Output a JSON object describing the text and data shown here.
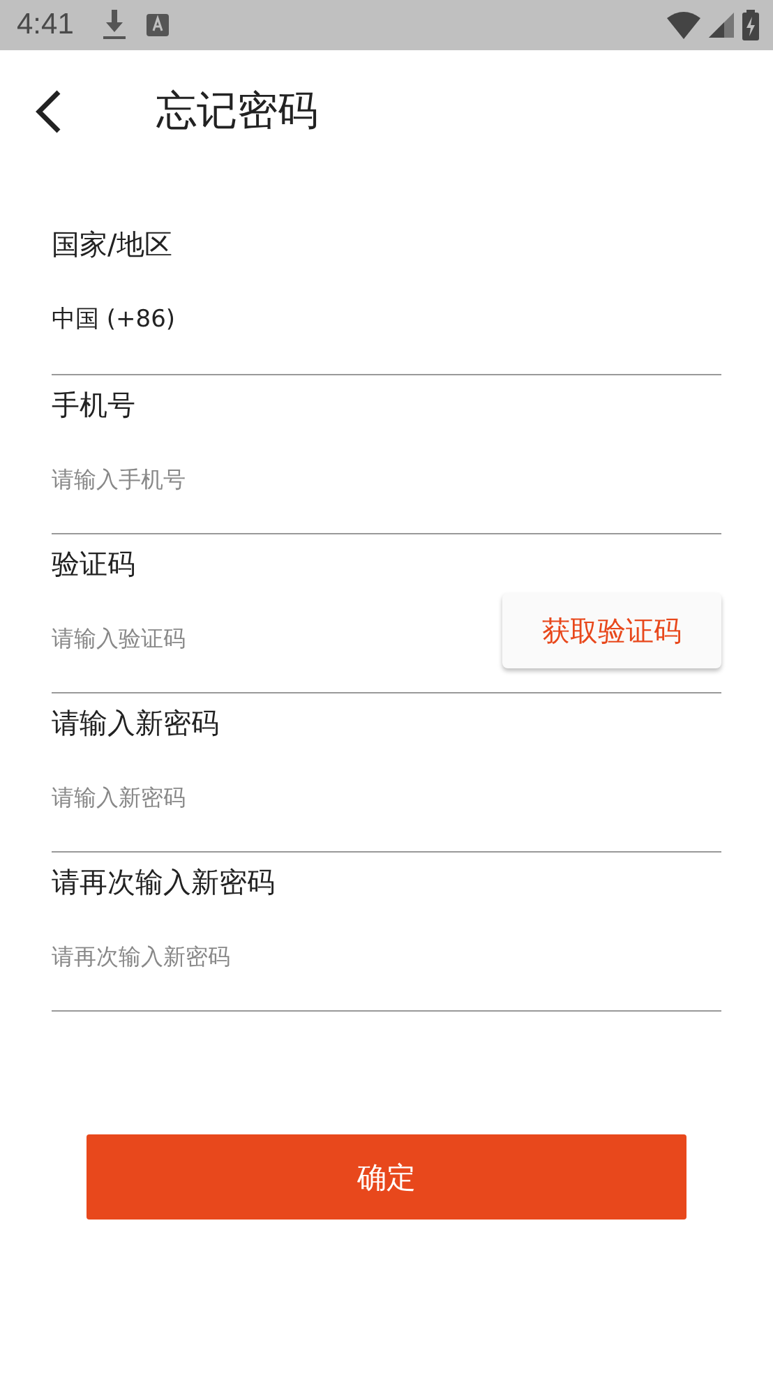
{
  "status_bar": {
    "time": "4:41"
  },
  "header": {
    "title": "忘记密码"
  },
  "fields": [
    {
      "kind": "select",
      "label": "国家/地区",
      "value": "中国 (+86)"
    },
    {
      "kind": "text",
      "label": "手机号",
      "placeholder": "请输入手机号"
    },
    {
      "kind": "code",
      "label": "验证码",
      "placeholder": "请输入验证码",
      "action": "获取验证码"
    },
    {
      "kind": "text",
      "label": "请输入新密码",
      "placeholder": "请输入新密码"
    },
    {
      "kind": "text",
      "label": "请再次输入新密码",
      "placeholder": "请再次输入新密码"
    }
  ],
  "submit": "确定"
}
